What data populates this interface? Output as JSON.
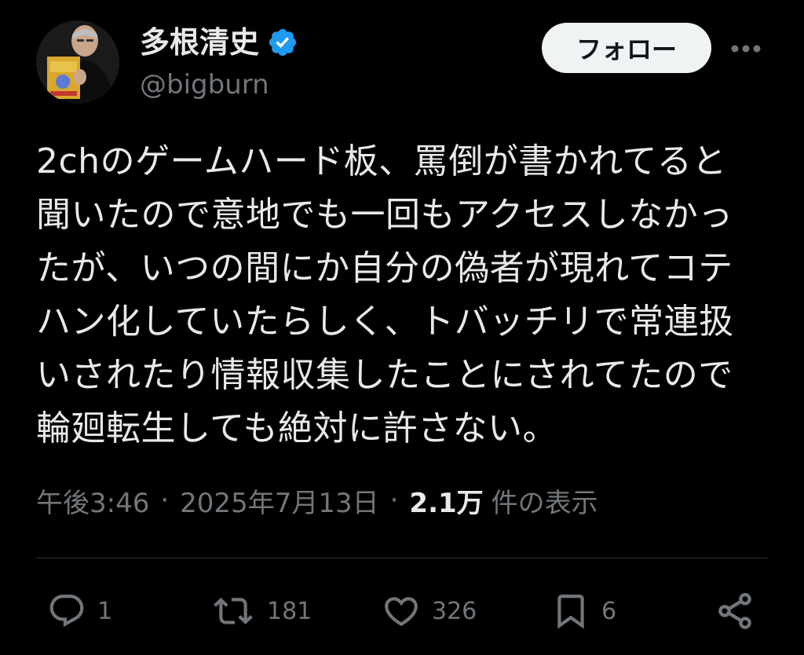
{
  "user": {
    "display_name": "多根清史",
    "handle": "@bigburn",
    "verified": true,
    "verified_color": "#1d9bf0",
    "avatar_icon": "profile-photo"
  },
  "header": {
    "follow_label": "フォロー",
    "more_icon": "more-horizontal-icon"
  },
  "tweet": {
    "lines": [
      "2chのゲームハード板、罵倒が書かれてると",
      "聞いたので意地でも一回もアクセスしなかっ",
      "たが、いつの間にか自分の偽者が現れてコテ",
      "ハン化していたらしく、トバッチリで常連扱",
      "いされたり情報収集したことにされてたので",
      "輪廻転生しても絶対に許さない。"
    ]
  },
  "meta": {
    "time": "午後3:46",
    "separator": "·",
    "date": "2025年7月13日",
    "views_count": "2.1万",
    "views_label": "件の表示"
  },
  "actions": {
    "replies": "1",
    "retweets": "181",
    "likes": "326",
    "bookmarks": "6"
  },
  "colors": {
    "background": "#000000",
    "text_primary": "#e7e9ea",
    "text_secondary": "#71767b",
    "divider": "#2f3336",
    "follow_bg": "#eff3f4"
  }
}
